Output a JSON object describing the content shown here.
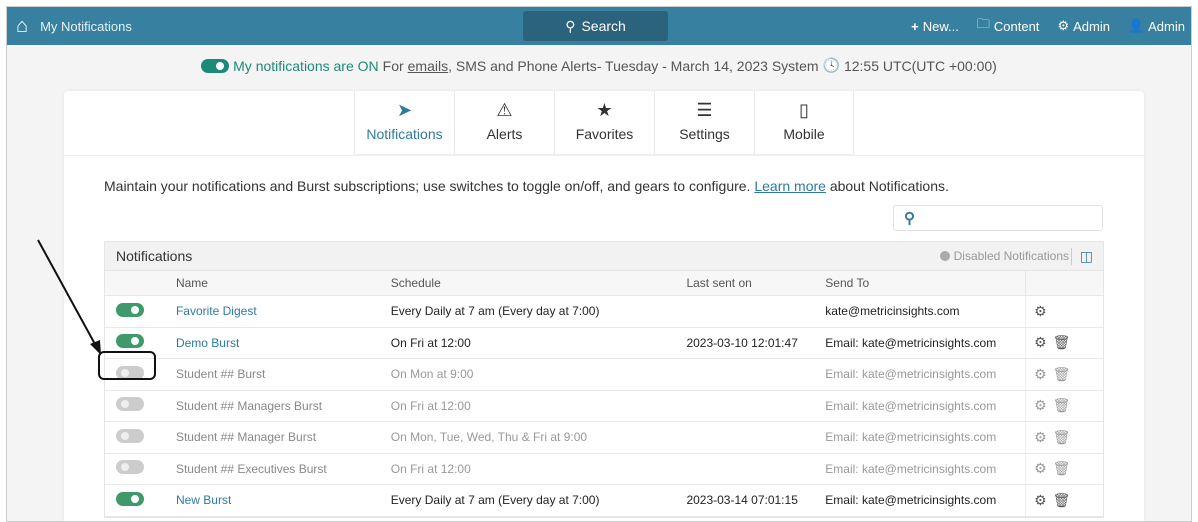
{
  "topbar": {
    "title": "My Notifications",
    "search": "Search",
    "new": "New...",
    "content": "Content",
    "admin1": "Admin",
    "admin2": "Admin"
  },
  "status": {
    "on": "My notifications are ON",
    "for": "For",
    "emails": "emails",
    "rest": ", SMS and Phone Alerts- Tuesday - March 14, 2023 System",
    "time": "12:55 UTC(UTC +00:00)"
  },
  "tabs": [
    {
      "label": "Notifications",
      "icon": "paper-plane"
    },
    {
      "label": "Alerts",
      "icon": "warning"
    },
    {
      "label": "Favorites",
      "icon": "star"
    },
    {
      "label": "Settings",
      "icon": "sliders"
    },
    {
      "label": "Mobile",
      "icon": "mobile"
    }
  ],
  "intro": {
    "text": "Maintain your notifications and Burst subscriptions; use switches to toggle on/off, and gears to configure.",
    "link": "Learn more",
    "tail": "about Notifications."
  },
  "table": {
    "title": "Notifications",
    "disabled": "Disabled Notifications",
    "columns": [
      "Name",
      "Schedule",
      "Last sent on",
      "Send To"
    ],
    "rows": [
      {
        "on": true,
        "name": "Favorite Digest",
        "schedule": "Every Daily at 7 am (Every day at 7:00)",
        "last": "",
        "to": "kate@metricinsights.com",
        "trash": false
      },
      {
        "on": true,
        "name": "Demo Burst",
        "schedule": "On Fri at 12:00",
        "last": "2023-03-10 12:01:47",
        "to": "Email: kate@metricinsights.com",
        "trash": true
      },
      {
        "on": false,
        "name": "Student ## Burst",
        "schedule": "On Mon at 9:00",
        "last": "",
        "to": "Email: kate@metricinsights.com",
        "trash": true
      },
      {
        "on": false,
        "name": "Student ## Managers Burst",
        "schedule": "On Fri at 12:00",
        "last": "",
        "to": "Email: kate@metricinsights.com",
        "trash": true
      },
      {
        "on": false,
        "name": "Student ## Manager Burst",
        "schedule": "On Mon, Tue, Wed, Thu & Fri at 9:00",
        "last": "",
        "to": "Email: kate@metricinsights.com",
        "trash": true
      },
      {
        "on": false,
        "name": "Student ## Executives Burst",
        "schedule": "On Fri at 12:00",
        "last": "",
        "to": "Email: kate@metricinsights.com",
        "trash": true
      },
      {
        "on": true,
        "name": "New Burst",
        "schedule": "Every Daily at 7 am (Every day at 7:00)",
        "last": "2023-03-14 07:01:15",
        "to": "Email: kate@metricinsights.com",
        "trash": true
      }
    ]
  }
}
